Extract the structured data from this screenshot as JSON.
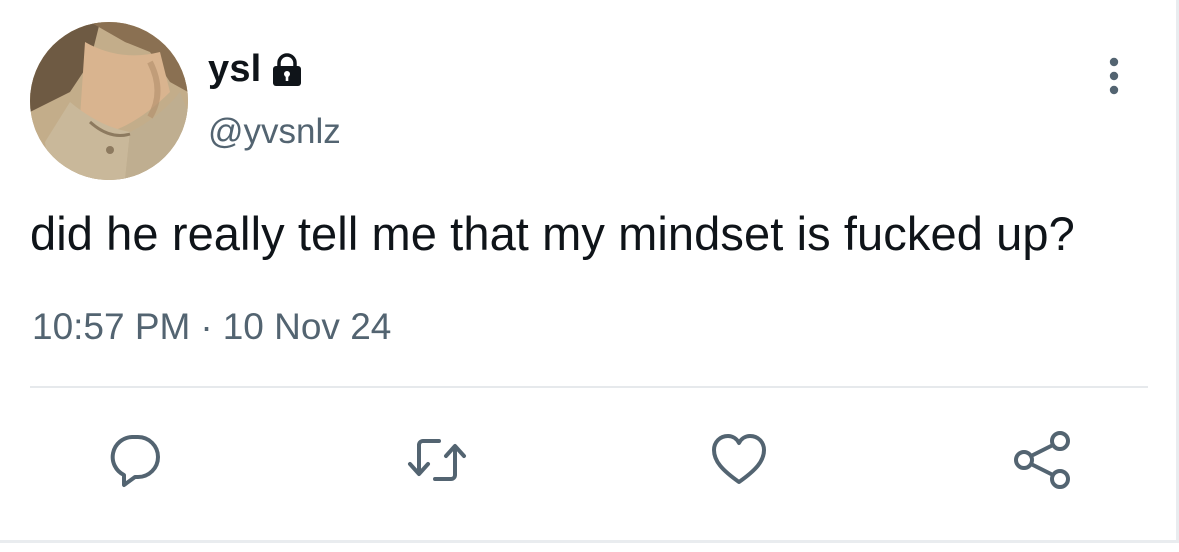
{
  "tweet": {
    "display_name": "ysl",
    "handle": "@yvsnlz",
    "text": "did he really tell me that my mindset is fucked up?",
    "time": "10:57 PM",
    "separator": "·",
    "date": "10 Nov 24",
    "protected": true
  },
  "actions": [
    {
      "name": "reply",
      "icon": "speech-bubble-icon"
    },
    {
      "name": "retweet",
      "icon": "retweet-arrows-icon"
    },
    {
      "name": "like",
      "icon": "heart-icon"
    },
    {
      "name": "share",
      "icon": "share-nodes-icon"
    }
  ],
  "colors": {
    "text_primary": "#0f1419",
    "text_secondary": "#536471",
    "divider": "#e6e9ec",
    "icon": "#536471"
  }
}
